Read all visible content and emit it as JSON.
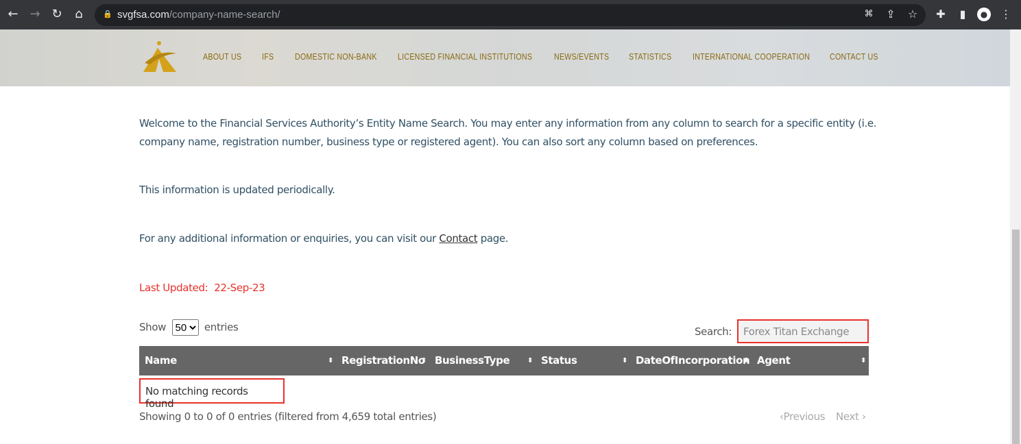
{
  "browser": {
    "url_domain": "svgfsa.com",
    "url_path": "/company-name-search/"
  },
  "nav": [
    "ABOUT US",
    "IFS",
    "DOMESTIC NON-BANK",
    "LICENSED FINANCIAL INSTITUTIONS",
    "NEWS/EVENTS",
    "STATISTICS",
    "INTERNATIONAL COOPERATION",
    "CONTACT US"
  ],
  "content": {
    "intro": "Welcome to the Financial Services Authority’s Entity Name Search. You may enter any information from any column to search for a specific entity (i.e. company name, registration number, business type or registered agent). You can also sort any column based on preferences.",
    "updated_note": "This information is updated periodically.",
    "contact_pre": "For any additional information or enquiries, you can visit our ",
    "contact_link": "Contact",
    "contact_post": " page.",
    "last_updated_label": "Last Updated:",
    "last_updated_value": "22-Sep-23"
  },
  "table": {
    "show_label": "Show",
    "entries_label": "entries",
    "page_size": "50",
    "search_label": "Search:",
    "search_value": "Forex Titan Exchange",
    "columns": [
      "Name",
      "RegistrationNo",
      "BusinessType",
      "Status",
      "DateOfIncorporation",
      "Agent"
    ],
    "empty_message": "No matching records found",
    "info": "Showing 0 to 0 of 0 entries (filtered from 4,659 total entries)",
    "previous": "Previous",
    "next": "Next"
  },
  "colors": {
    "nav": "#8a6a12",
    "highlight": "#e8312b",
    "table_header": "#666666"
  }
}
